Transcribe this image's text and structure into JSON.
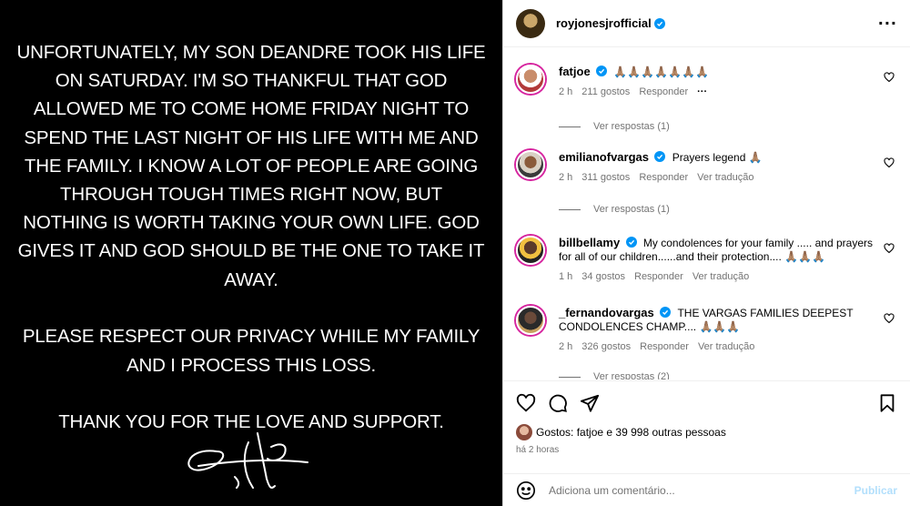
{
  "post": {
    "paragraphs": [
      "UNFORTUNATELY, MY SON DEANDRE TOOK HIS LIFE ON SATURDAY. I'M SO THANKFUL THAT GOD ALLOWED ME TO COME HOME FRIDAY NIGHT TO SPEND THE LAST NIGHT OF HIS LIFE WITH ME AND THE FAMILY. I KNOW A LOT OF PEOPLE ARE GOING THROUGH TOUGH TIMES RIGHT NOW, BUT NOTHING IS WORTH TAKING YOUR OWN LIFE. GOD GIVES IT AND GOD SHOULD BE THE ONE TO TAKE IT AWAY.",
      "PLEASE RESPECT OUR PRIVACY WHILE MY FAMILY AND I PROCESS THIS LOSS.",
      "THANK YOU FOR THE LOVE AND SUPPORT."
    ]
  },
  "header": {
    "username": "royjonesjrofficial",
    "more_icon": "more-icon"
  },
  "comments": [
    {
      "username": "fatjoe",
      "text": "🙏🏽🙏🏽🙏🏽🙏🏽🙏🏽🙏🏽🙏🏽",
      "time": "2 h",
      "likes": "211 gostos",
      "reply": "Responder",
      "extra": "···",
      "replies": "Ver respostas (1)"
    },
    {
      "username": "emilianofvargas",
      "text": "Prayers legend 🙏🏽",
      "time": "2 h",
      "likes": "311 gostos",
      "reply": "Responder",
      "translate": "Ver tradução",
      "replies": "Ver respostas (1)"
    },
    {
      "username": "billbellamy",
      "text": "My condolences for your family ..... and prayers for all of our children......and their protection.... 🙏🏽🙏🏽🙏🏽",
      "time": "1 h",
      "likes": "34 gostos",
      "reply": "Responder",
      "translate": "Ver tradução"
    },
    {
      "username": "_fernandovargas",
      "text": "THE VARGAS FAMILIES DEEPEST CONDOLENCES CHAMP.... 🙏🏽🙏🏽🙏🏽",
      "time": "2 h",
      "likes": "326 gostos",
      "reply": "Responder",
      "translate": "Ver tradução",
      "replies": "Ver respostas (2)"
    }
  ],
  "likes": {
    "prefix": "Gostos:",
    "liker": "fatjoe",
    "rest": "e 39 998 outras pessoas"
  },
  "time_ago": "há 2 horas",
  "add_comment": {
    "placeholder": "Adiciona um comentário...",
    "publish": "Publicar"
  },
  "colors": {
    "verified": "#0095f6",
    "publish": "#b2dffc",
    "muted": "#737373"
  }
}
